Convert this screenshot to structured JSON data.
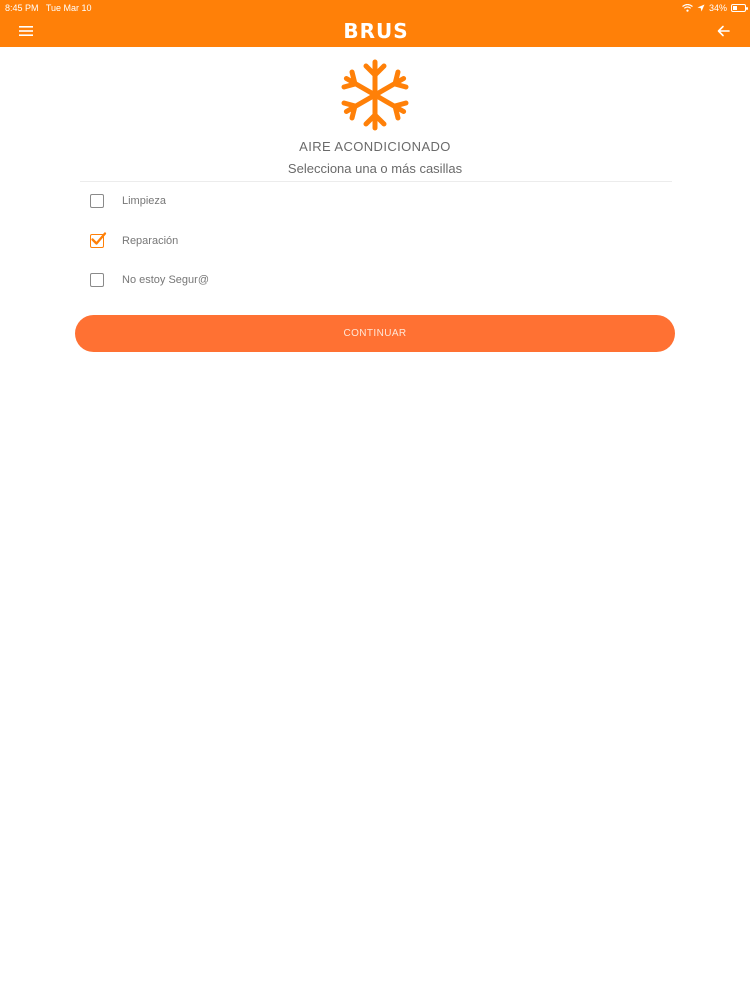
{
  "status_bar": {
    "time": "8:45 PM",
    "date": "Tue Mar 10",
    "battery_percent": "34%",
    "battery_level": 0.34,
    "icons": [
      "wifi-icon",
      "location-icon",
      "battery-icon"
    ]
  },
  "header": {
    "logo_text": "BRUS",
    "menu_icon": "hamburger-menu-icon",
    "back_icon": "arrow-left-icon",
    "background": "#ff8008"
  },
  "main": {
    "hero_icon": "snowflake-icon",
    "title": "AIRE ACONDICIONADO",
    "subtitle": "Selecciona una o más casillas",
    "options": [
      {
        "label": "Limpieza",
        "checked": false
      },
      {
        "label": "Reparación",
        "checked": true
      },
      {
        "label": "No estoy Segur@",
        "checked": false
      }
    ],
    "continue_label": "CONTINUAR",
    "accent": "#ff7133"
  }
}
